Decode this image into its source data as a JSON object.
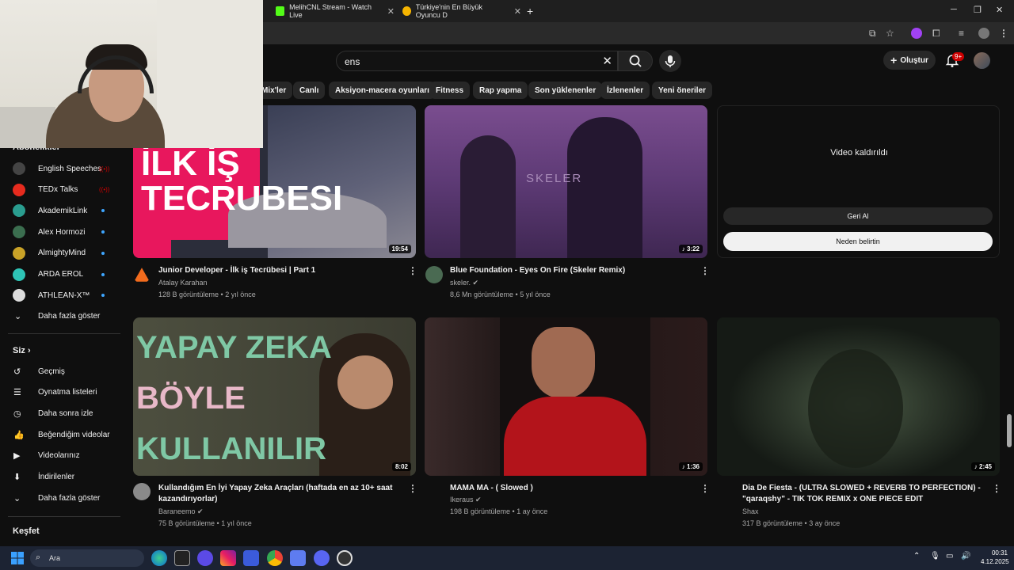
{
  "browser": {
    "tabs": [
      {
        "title": "MelihCNL Stream - Watch Live"
      },
      {
        "title": "Türkiye'nin En Büyük Oyuncu D"
      }
    ],
    "new_tab": "+",
    "window": {
      "minimize": "─",
      "restore": "❐",
      "close": "✕"
    }
  },
  "header": {
    "search_value": "ens",
    "create_label": "Oluştur",
    "notif_count": "9+"
  },
  "chips": [
    "Mix'ler",
    "Canlı",
    "Aksiyon-macera oyunları",
    "Fitness",
    "Rap yapma",
    "Son yüklenenler",
    "İzlenenler",
    "Yeni öneriler"
  ],
  "sidebar": {
    "subs_heading": "Abonelikler",
    "subscriptions": [
      {
        "label": "English Speeches",
        "color": "#444444",
        "live": true
      },
      {
        "label": "TEDx Talks",
        "color": "#e62b1e",
        "live": true
      },
      {
        "label": "AkademikLink",
        "color": "#2a9d8f",
        "live": false
      },
      {
        "label": "Alex Hormozi",
        "color": "#3b6e4f",
        "live": false
      },
      {
        "label": "AlmightyMind",
        "color": "#c9a227",
        "live": false
      },
      {
        "label": "ARDA EROL",
        "color": "#2ec4b6",
        "live": false
      },
      {
        "label": "ATHLEAN-X™",
        "color": "#dddddd",
        "live": false
      }
    ],
    "subs_more": "Daha fazla göster",
    "you_heading": "Siz",
    "you_items": [
      "Geçmiş",
      "Oynatma listeleri",
      "Daha sonra izle",
      "Beğendiğim videolar",
      "Videolarınız",
      "İndirilenler",
      "Daha fazla göster"
    ],
    "explore_heading": "Keşfet"
  },
  "videos": [
    {
      "title": "Junior Developer - İlk iş Tecrübesi | Part 1",
      "channel": "Atalay Karahan",
      "meta": "128 B görüntüleme • 2 yıl önce",
      "duration": "19:54",
      "thumb_text": "İLK İŞ TECRUBESI"
    },
    {
      "title": "Blue Foundation - Eyes On Fire (Skeler Remix)",
      "channel": "skeler.",
      "meta": "8,6 Mn görüntüleme • 5 yıl önce",
      "duration": "♪ 3:22",
      "thumb_text": "SKELER"
    },
    {
      "title": "Kullandığım En İyi Yapay Zeka Araçları (haftada en az 10+ saat kazandırıyorlar)",
      "channel": "Baraneemo",
      "meta": "75 B görüntüleme • 1 yıl önce",
      "duration": "8:02",
      "thumb_text": [
        "YAPAY ZEKA",
        "BÖYLE",
        "KULLANILIR"
      ]
    },
    {
      "title": "MAMA MA - ( Slowed )",
      "channel": "Ikeraus",
      "meta": "198 B görüntüleme • 1 ay önce",
      "duration": "♪ 1:36"
    },
    {
      "title": "Dia De Fiesta - (ULTRA SLOWED + REVERB TO PERFECTION) - \"qaraqshy\" - TIK TOK REMIX x ONE PIECE EDIT",
      "channel": "Shax",
      "meta": "317 B görüntüleme • 3 ay önce",
      "duration": "♪ 2:45"
    }
  ],
  "removed": {
    "message": "Video kaldırıldı",
    "undo_label": "Geri Al",
    "why_label": "Neden belirtin"
  },
  "taskbar": {
    "search_placeholder": "Ara",
    "time": "00:31",
    "date": "4.12.2025"
  }
}
